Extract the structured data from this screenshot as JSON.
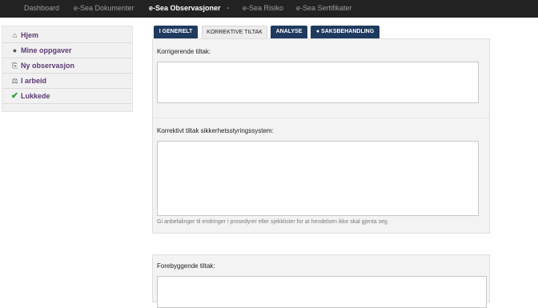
{
  "navbar": {
    "items": [
      {
        "label": "Dashboard"
      },
      {
        "label": "e-Sea Dokumenter"
      },
      {
        "label": "e-Sea Observasjoner",
        "caret": "▫"
      },
      {
        "label": "e-Sea Risiko"
      },
      {
        "label": "e-Sea Sertifikater"
      }
    ]
  },
  "sidebar": {
    "items": [
      {
        "label": "Hjem",
        "icon": "home-icon",
        "glyph": "⌂"
      },
      {
        "label": "Mine oppgaver",
        "icon": "speech-bubble-icon",
        "glyph": "●"
      },
      {
        "label": "Ny observasjon",
        "icon": "clipboard-icon",
        "glyph": "⎘"
      },
      {
        "label": "I arbeid",
        "icon": "scale-icon",
        "glyph": "⚖"
      },
      {
        "label": "Lukkede",
        "icon": "checkmark-icon",
        "glyph": "✔"
      }
    ]
  },
  "tabs": [
    {
      "label": "GENERELT",
      "icon": "info-icon",
      "glyph": "i"
    },
    {
      "label": "KORREKTIVE TILTAK"
    },
    {
      "label": "ANALYSE"
    },
    {
      "label": "SAKSBEHANDLING",
      "icon": "speech-bubble-icon",
      "glyph": "●"
    }
  ],
  "form": {
    "korrigerende_label": "Korrigerende tiltak:",
    "korrigerende_value": "",
    "korrektivt_label": "Korrektivt tiltak sikkerhetsstyringssystem:",
    "korrektivt_value": "",
    "korrektivt_help": "Gi anbefalinger til endringer i prosedyrer eller sjekklister for at hendelsen ikke skal gjenta seg",
    "forebyggende_label": "Forebyggende tiltak:",
    "forebyggende_value": ""
  },
  "colors": {
    "navbar": "#222222",
    "tab_active": "#1f3a5f",
    "sidebar_text": "#5b3a73",
    "check": "#2ea043"
  }
}
